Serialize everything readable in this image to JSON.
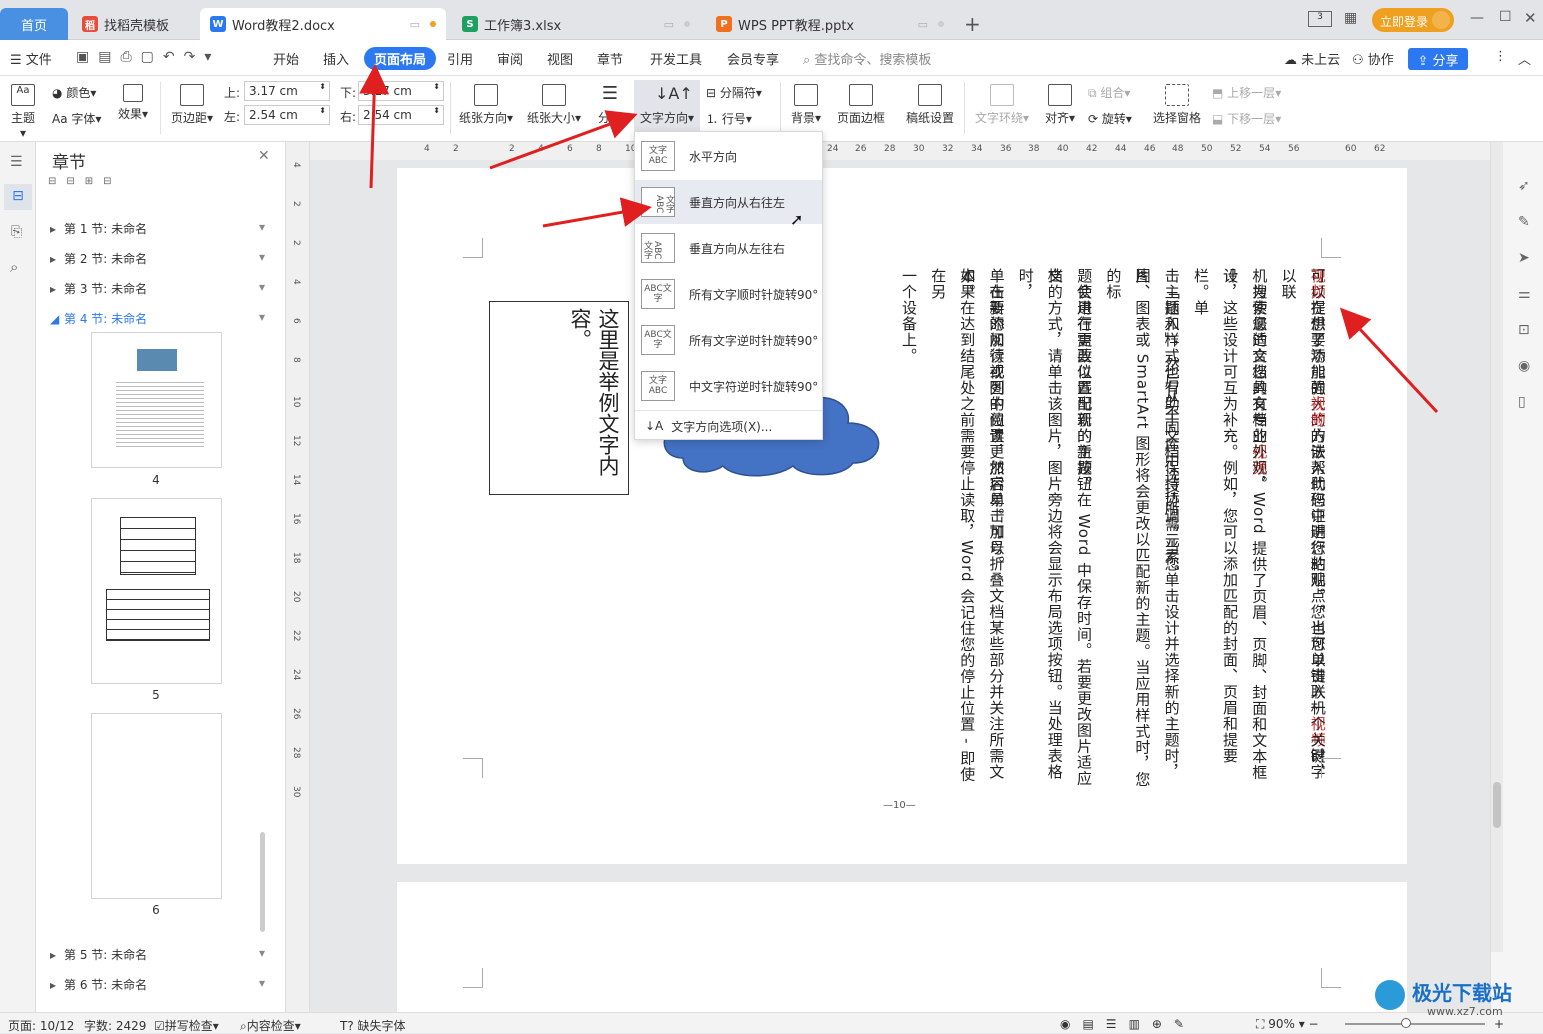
{
  "tabs": [
    {
      "label": "首页"
    },
    {
      "label": "找稻壳模板"
    },
    {
      "label": "Word教程2.docx"
    },
    {
      "label": "工作簿3.xlsx"
    },
    {
      "label": "WPS PPT教程.pptx"
    }
  ],
  "login_label": "立即登录",
  "menu": {
    "file": "文件",
    "items": [
      "开始",
      "插入",
      "页面布局",
      "引用",
      "审阅",
      "视图",
      "章节",
      "开发工具",
      "会员专享"
    ],
    "search": "查找命令、搜索模板",
    "cloud": "未上云",
    "collab": "协作",
    "share": "分享"
  },
  "ribbon": {
    "theme": "主题",
    "colors": "颜色",
    "fonts": "Aa 字体",
    "effects": "效果",
    "margins": "页边距",
    "top_label": "上:",
    "top_val": "3.17 cm",
    "bottom_label": "下:",
    "bottom_val": "3.17 cm",
    "left_label": "左:",
    "left_val": "2.54 cm",
    "right_label": "右:",
    "right_val": "2.54 cm",
    "orientation": "纸张方向",
    "size": "纸张大小",
    "columns": "分栏",
    "text_direction": "文字方向",
    "breaks": "分隔符",
    "line_numbers": "行号",
    "background": "背景",
    "borders": "页面边框",
    "grid": "稿纸设置",
    "wrap": "文字环绕",
    "align": "对齐",
    "group": "组合",
    "rotate": "旋转",
    "selection": "选择窗格",
    "bring_forward": "上移一层",
    "send_backward": "下移一层"
  },
  "nav": {
    "title": "章节",
    "sections": [
      "第 1 节: 未命名",
      "第 2 节: 未命名",
      "第 3 节: 未命名",
      "第 4 节: 未命名",
      "第 5 节: 未命名",
      "第 6 节: 未命名"
    ],
    "page_numbers": [
      "4",
      "5",
      "6"
    ]
  },
  "dropdown": {
    "items": [
      "水平方向",
      "垂直方向从右往左",
      "垂直方向从左往右",
      "所有文字顺时针旋转90°",
      "所有文字逆时针旋转90°",
      "中文字符逆时针旋转90°"
    ],
    "icon_text": [
      "文字ABC",
      "文字ABC",
      "文字ABC",
      "ABC文字",
      "ABC文字",
      "文字ABC"
    ],
    "options": "文字方向选项(X)..."
  },
  "ruler": {
    "marks": [
      "4",
      "2",
      "2",
      "4",
      "6",
      "8",
      "10",
      "12",
      "14",
      "16",
      "18",
      "20",
      "22",
      "24",
      "26",
      "28",
      "30",
      "32",
      "34",
      "36",
      "38",
      "40",
      "42",
      "44",
      "46",
      "48",
      "50",
      "52",
      "54",
      "56",
      "60",
      "62"
    ],
    "vmarks": [
      "4",
      "2",
      "2",
      "4",
      "6",
      "8",
      "10",
      "12",
      "14",
      "16",
      "18",
      "20",
      "22",
      "24",
      "26",
      "28",
      "30"
    ]
  },
  "document": {
    "textbox": "这里是举例文字内容。",
    "page_footer": "—10—",
    "columns": [
      [
        {
          "t": "视频",
          "r": true
        },
        {
          "t": "提供了功能强大的方法帮助您证明您的观点。当您单击联机"
        },
        {
          "t": "视频",
          "r": true
        },
        {
          "t": "时，"
        }
      ],
      [
        {
          "t": "可以在想要添加的"
        },
        {
          "t": "视频",
          "r": true
        },
        {
          "t": "的嵌入代码中进行粘贴。您也可以键入一个关键字以联"
        }
      ],
      [
        {
          "t": "机搜索最适合您的文档的"
        },
        {
          "t": "视频",
          "r": true
        },
        {
          "t": "。"
        }
      ],
      [
        {
          "t": "　为使您的文档具有专业外观，Word 提供了页眉、页脚、封面和文本框设"
        }
      ],
      [
        {
          "t": "计，这些设计可互为补充。例如，您可以添加匹配的封面、页眉和提要栏。单"
        }
      ],
      [
        {
          "t": "击「插入」，然后从不同库中选择所需元素。"
        }
      ],
      [
        {
          "t": "　主题和样式也有助于文档保持协调。当您单击设计并选择新的主题时，图"
        }
      ],
      [
        {
          "t": "片、图表或 SmartArt 图形将会更改以匹配新的主题。当应用样式时，您的标"
        }
      ],
      [
        {
          "t": "题会进行更改以匹配新的主题。"
        }
      ],
      [
        {
          "t": "　使用在需要位置出现的新按钮在 Word 中保存时间。若要更改图片适应文"
        }
      ],
      [
        {
          "t": "档的方式，请单击该图片，图片旁边将会显示布局选项按钮。当处理表格时，"
        }
      ],
      [
        {
          "t": "单击要添加行或列的位置，然后单击加号。"
        }
      ],
      [
        {
          "t": "　在新的阅读视图中阅读更加容易。可以折叠文档某些部分并关注所需文本。"
        }
      ],
      [
        {
          "t": "如果在达到结尾处之前需要停止读取，Word 会记住您的停止位置 - 即使在另"
        }
      ],
      [
        {
          "t": "一个设备上。"
        }
      ]
    ]
  },
  "status": {
    "page": "页面: 10/12",
    "words": "字数: 2429",
    "spell": "拼写检查",
    "content": "内容检查",
    "font": "缺失字体",
    "zoom": "90%"
  },
  "watermark": {
    "text": "极光下载站",
    "url": "www.xz7.com"
  }
}
